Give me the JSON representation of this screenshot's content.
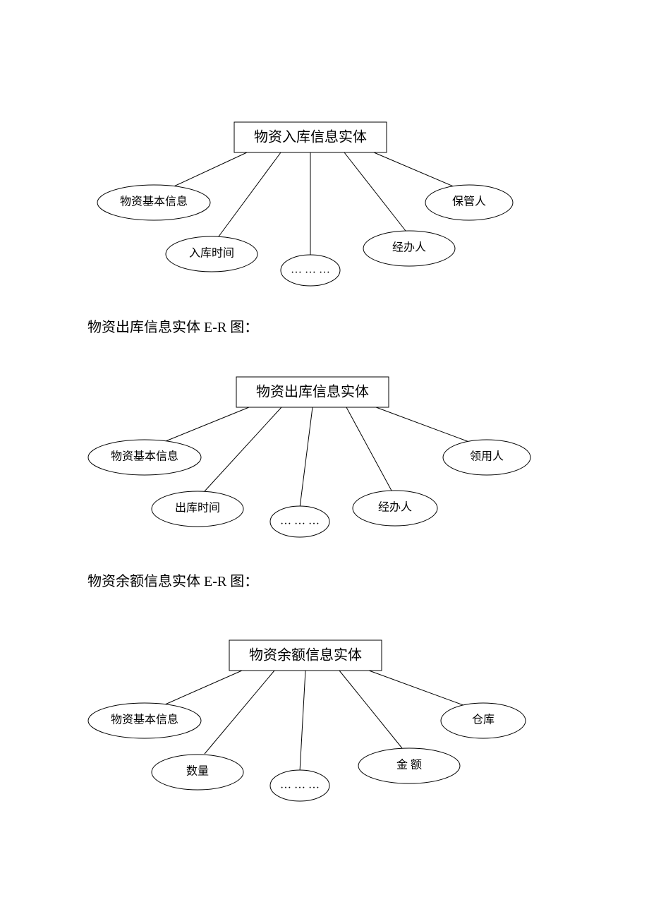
{
  "diagram1": {
    "entity": "物资入库信息实体",
    "attrs": {
      "a1": "物资基本信息",
      "a2": "入库时间",
      "a3": "… … …",
      "a4": "经办人",
      "a5": "保管人"
    }
  },
  "caption2": "物资出库信息实体 E-R 图：",
  "diagram2": {
    "entity": "物资出库信息实体",
    "attrs": {
      "a1": "物资基本信息",
      "a2": "出库时间",
      "a3": "… … …",
      "a4": "经办人",
      "a5": "领用人"
    }
  },
  "caption3": "物资余额信息实体 E-R 图：",
  "diagram3": {
    "entity": "物资余额信息实体",
    "attrs": {
      "a1": "物资基本信息",
      "a2": "数量",
      "a3": "… … …",
      "a4": "金   额",
      "a5": "仓库"
    }
  }
}
